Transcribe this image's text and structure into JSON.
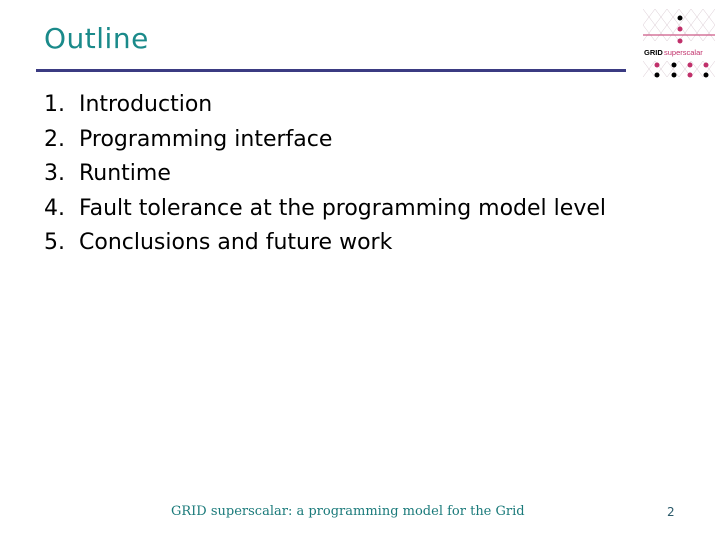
{
  "slide": {
    "title": "Outline",
    "items": [
      {
        "number": "1.",
        "text": "Introduction"
      },
      {
        "number": "2.",
        "text": "Programming interface"
      },
      {
        "number": "3.",
        "text": "Runtime"
      },
      {
        "number": "4.",
        "text": "Fault tolerance at the programming model level"
      },
      {
        "number": "5.",
        "text": "Conclusions and future work"
      }
    ],
    "footer": "GRID superscalar: a programming model for the Grid",
    "page_number": "2"
  },
  "logo": {
    "text_grid": "GRID",
    "text_superscalar": "superscalar"
  },
  "colors": {
    "title": "#1a8a8a",
    "rule": "#3b3b82",
    "logo_pink": "#c0306a",
    "footer": "#1a7a7a"
  }
}
